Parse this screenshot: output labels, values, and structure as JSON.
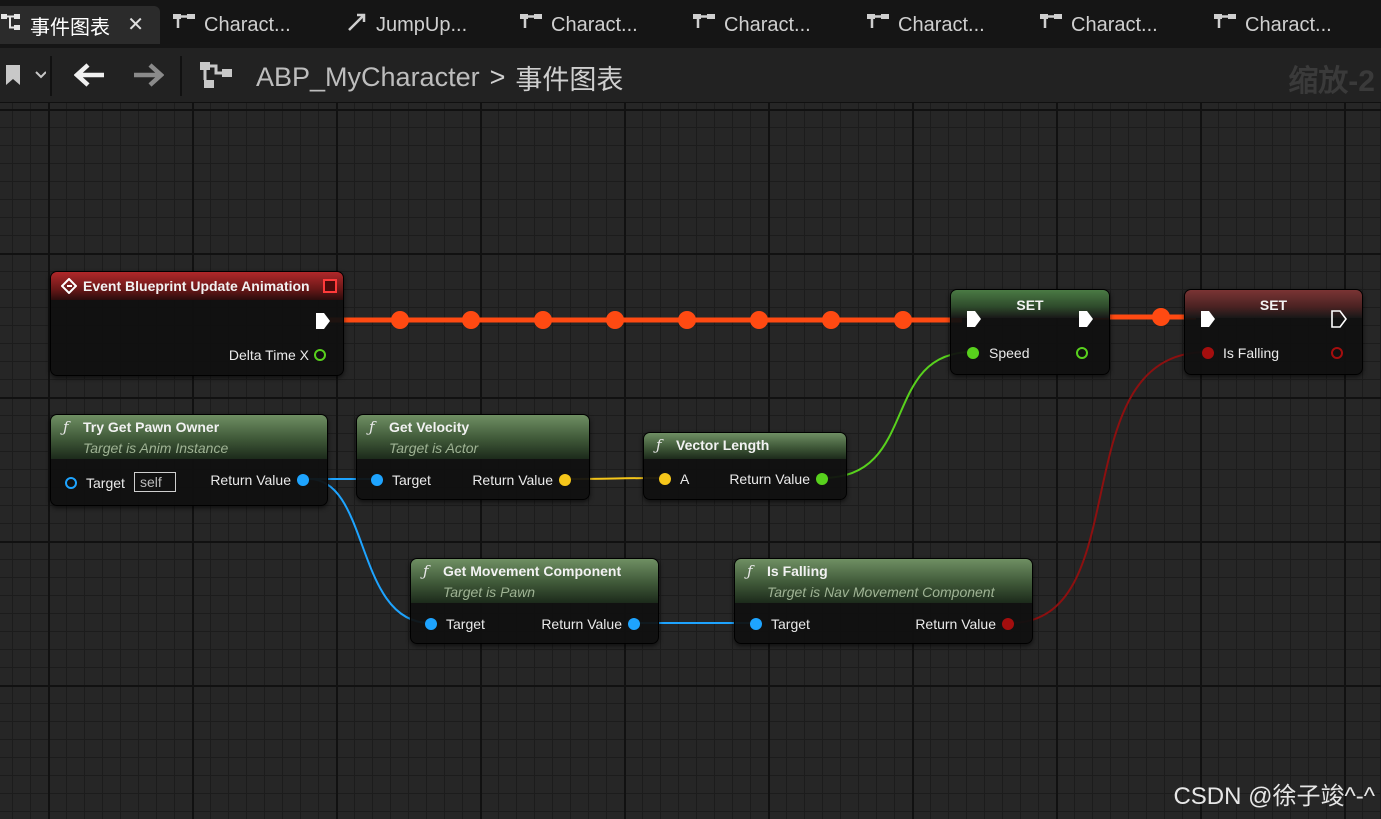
{
  "tabs": [
    {
      "label": "事件图表",
      "icon": "graph-icon",
      "active": true
    },
    {
      "label": "Charact...",
      "icon": "graph-icon"
    },
    {
      "label": "JumpUp...",
      "icon": "diagonal-arrow-icon"
    },
    {
      "label": "Charact...",
      "icon": "graph-icon"
    },
    {
      "label": "Charact...",
      "icon": "graph-icon"
    },
    {
      "label": "Charact...",
      "icon": "graph-icon"
    },
    {
      "label": "Charact...",
      "icon": "graph-icon"
    },
    {
      "label": "Charact...",
      "icon": "graph-icon"
    }
  ],
  "toolbar": {
    "breadcrumb_root": "ABP_MyCharacter",
    "breadcrumb_separator": ">",
    "breadcrumb_current": "事件图表",
    "zoom_label": "缩放-2"
  },
  "nodes": {
    "event_update": {
      "title": "Event Blueprint Update Animation",
      "pin_delta": "Delta Time X"
    },
    "try_get_pawn": {
      "title": "Try Get Pawn Owner",
      "subtitle": "Target is Anim Instance",
      "pin_target": "Target",
      "pin_self": "self",
      "pin_return": "Return Value"
    },
    "get_velocity": {
      "title": "Get Velocity",
      "subtitle": "Target is Actor",
      "pin_target": "Target",
      "pin_return": "Return Value"
    },
    "vector_length": {
      "title": "Vector Length",
      "pin_a": "A",
      "pin_return": "Return Value"
    },
    "set_speed": {
      "title": "SET",
      "pin_var": "Speed"
    },
    "set_falling": {
      "title": "SET",
      "pin_var": "Is Falling"
    },
    "get_movement": {
      "title": "Get Movement Component",
      "subtitle": "Target is Pawn",
      "pin_target": "Target",
      "pin_return": "Return Value"
    },
    "is_falling": {
      "title": "Is Falling",
      "subtitle": "Target is Nav Movement Component",
      "pin_target": "Target",
      "pin_return": "Return Value"
    }
  },
  "function_icon": "ƒ",
  "watermark": "CSDN @徐子竣^-^",
  "colors": {
    "exec_wire": "#ff4a12",
    "object_pin": "#1ea4ff",
    "vector_pin": "#f5c61a",
    "float_pin": "#58d11d",
    "bool_pin": "#a40e0e",
    "event_header": "#b0282a",
    "function_header": "#6f8f63"
  }
}
